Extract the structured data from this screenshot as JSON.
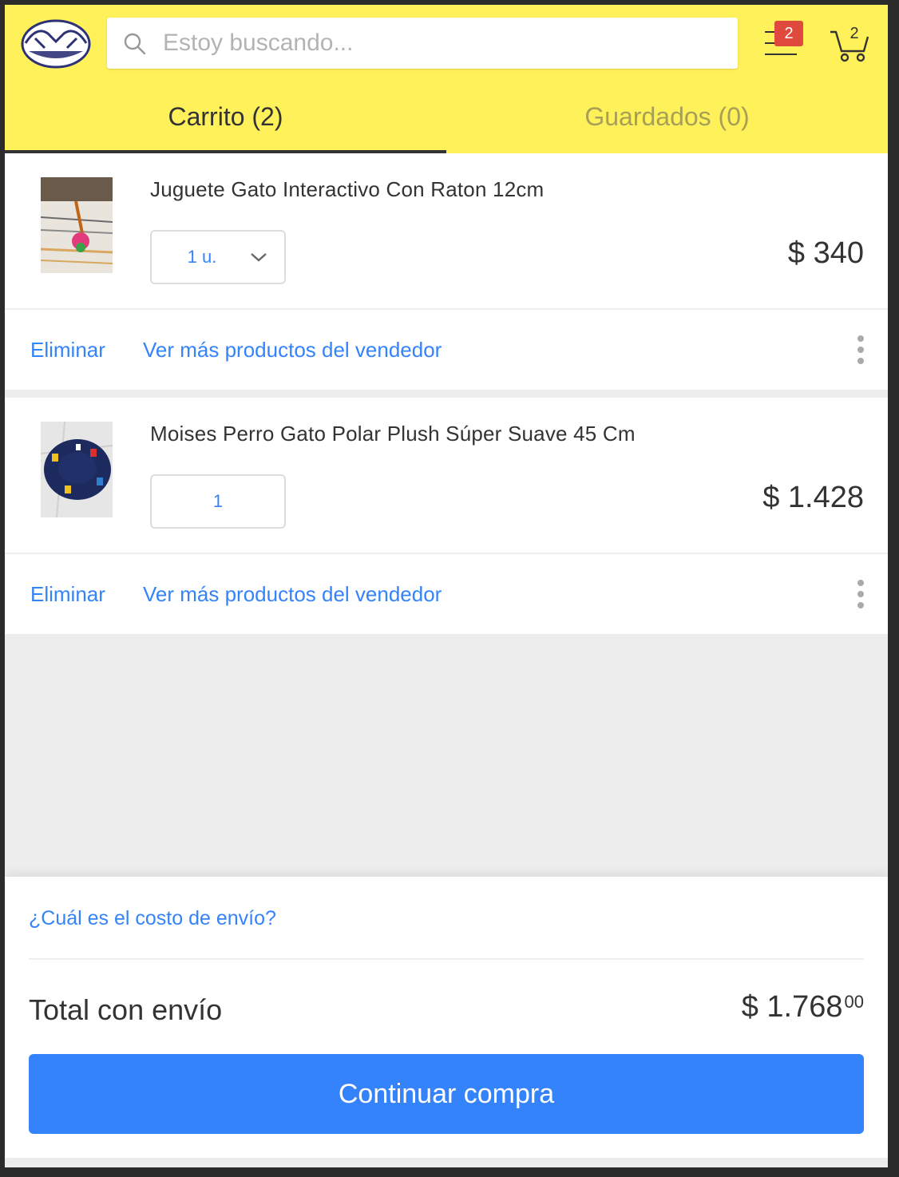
{
  "header": {
    "search_placeholder": "Estoy buscando...",
    "menu_badge": "2",
    "cart_count": "2",
    "brand_color": "#fff159",
    "badge_color": "#e0493d"
  },
  "tabs": [
    {
      "label": "Carrito (2)",
      "active": true
    },
    {
      "label": "Guardados (0)",
      "active": false
    }
  ],
  "items": [
    {
      "title": "Juguete Gato Interactivo Con Raton 12cm",
      "quantity": "1 u.",
      "price": "$ 340",
      "remove_label": "Eliminar",
      "more_label": "Ver más productos del vendedor"
    },
    {
      "title": "Moises Perro Gato Polar Plush Súper Suave 45 Cm",
      "quantity": "1",
      "price": "$ 1.428",
      "remove_label": "Eliminar",
      "more_label": "Ver más productos del vendedor"
    }
  ],
  "summary": {
    "shipping_question": "¿Cuál es el costo de envío?",
    "total_label": "Total con envío",
    "total_value": "$ 1.768",
    "total_cents": "00",
    "continue_label": "Continuar compra",
    "accent_color": "#3483fa"
  }
}
